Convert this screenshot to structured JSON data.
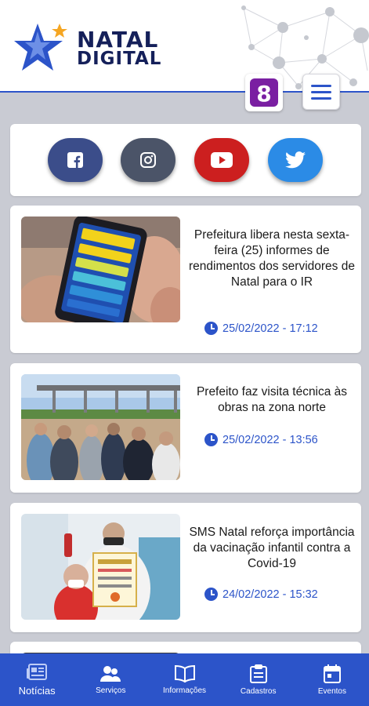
{
  "header": {
    "logo_line1": "NATAL",
    "logo_line2": "DIGITAL",
    "badge_8": "8",
    "colors": {
      "brand_blue": "#2c54c9",
      "logo_navy": "#15205a",
      "star_orange": "#f5a623",
      "badge_purple": "#7a1fa2"
    }
  },
  "social": {
    "items": [
      {
        "name": "facebook",
        "icon": "facebook-icon",
        "color": "#3b4d8a"
      },
      {
        "name": "instagram",
        "icon": "instagram-icon",
        "color": "#4b5468"
      },
      {
        "name": "youtube",
        "icon": "youtube-icon",
        "color": "#cc1f1f"
      },
      {
        "name": "twitter",
        "icon": "twitter-icon",
        "color": "#2b8be6"
      }
    ]
  },
  "news": [
    {
      "title": "Prefeitura libera nesta sexta-feira (25) informes de rendimentos dos servidores de Natal para o IR",
      "datetime": "25/02/2022 - 17:12",
      "image": "phone-iptu-app-photo"
    },
    {
      "title": "Prefeito faz visita técnica às obras na zona norte",
      "datetime": "25/02/2022 - 13:56",
      "image": "bridge-construction-visit-photo"
    },
    {
      "title": "SMS Natal reforça importância da vacinação infantil contra a Covid-19",
      "datetime": "24/02/2022 - 15:32",
      "image": "child-vaccination-certificate-photo"
    }
  ],
  "bottom_nav": {
    "active": 0,
    "items": [
      {
        "label": "Notícias",
        "icon": "newspaper-icon"
      },
      {
        "label": "Serviços",
        "icon": "people-icon"
      },
      {
        "label": "Informações",
        "icon": "book-icon"
      },
      {
        "label": "Cadastros",
        "icon": "clipboard-icon"
      },
      {
        "label": "Eventos",
        "icon": "calendar-icon"
      }
    ]
  }
}
